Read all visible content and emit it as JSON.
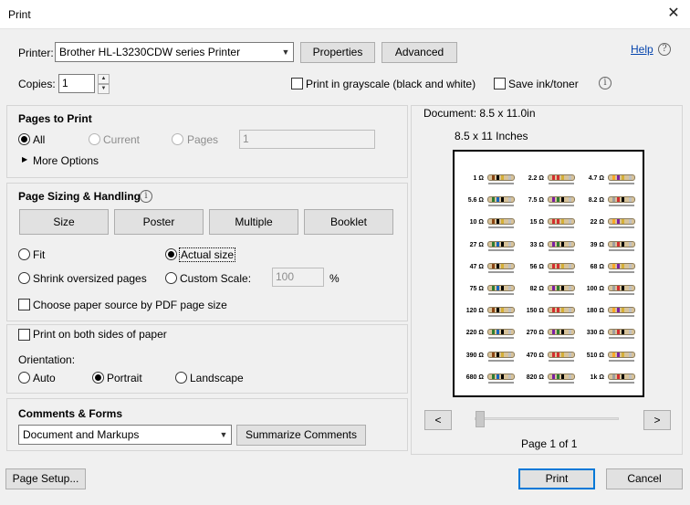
{
  "window": {
    "title": "Print",
    "close_glyph": "✕"
  },
  "help": {
    "label": "Help",
    "glyph": "?"
  },
  "printer": {
    "label": "Printer:",
    "selected": "Brother HL-L3230CDW series Printer",
    "properties_label": "Properties",
    "advanced_label": "Advanced"
  },
  "copies": {
    "label": "Copies:",
    "value": "1"
  },
  "options": {
    "grayscale_label": "Print in grayscale (black and white)",
    "grayscale_checked": false,
    "save_ink_label": "Save ink/toner",
    "save_ink_checked": false
  },
  "pages_to_print": {
    "heading": "Pages to Print",
    "all_label": "All",
    "current_label": "Current",
    "pages_label": "Pages",
    "pages_value": "1",
    "more_options_label": "More Options"
  },
  "sizing": {
    "heading": "Page Sizing & Handling",
    "tabs": [
      "Size",
      "Poster",
      "Multiple",
      "Booklet"
    ],
    "fit_label": "Fit",
    "actual_size_label": "Actual size",
    "shrink_label": "Shrink oversized pages",
    "custom_scale_label": "Custom Scale:",
    "custom_scale_value": "100",
    "percent": "%",
    "paper_source_label": "Choose paper source by PDF page size"
  },
  "duplex": {
    "both_sides_label": "Print on both sides of paper",
    "orientation_label": "Orientation:",
    "auto_label": "Auto",
    "portrait_label": "Portrait",
    "landscape_label": "Landscape"
  },
  "comments": {
    "heading": "Comments & Forms",
    "selected": "Document and Markups",
    "summarize_label": "Summarize Comments"
  },
  "preview": {
    "document_label": "Document: 8.5 x 11.0in",
    "size_label": "8.5 x 11 Inches",
    "page_label": "Page 1 of 1",
    "prev_glyph": "<",
    "next_glyph": ">",
    "resistor_values": [
      "1 Ω",
      "2.2 Ω",
      "4.7 Ω",
      "5.6 Ω",
      "7.5 Ω",
      "8.2 Ω",
      "10 Ω",
      "15 Ω",
      "22 Ω",
      "27 Ω",
      "33 Ω",
      "39 Ω",
      "47 Ω",
      "56 Ω",
      "68 Ω",
      "75 Ω",
      "82 Ω",
      "100 Ω",
      "120 Ω",
      "150 Ω",
      "180 Ω",
      "220 Ω",
      "270 Ω",
      "330 Ω",
      "390 Ω",
      "470 Ω",
      "510 Ω",
      "680 Ω",
      "820 Ω",
      "1k Ω"
    ]
  },
  "footer": {
    "page_setup_label": "Page Setup...",
    "print_label": "Print",
    "cancel_label": "Cancel"
  }
}
